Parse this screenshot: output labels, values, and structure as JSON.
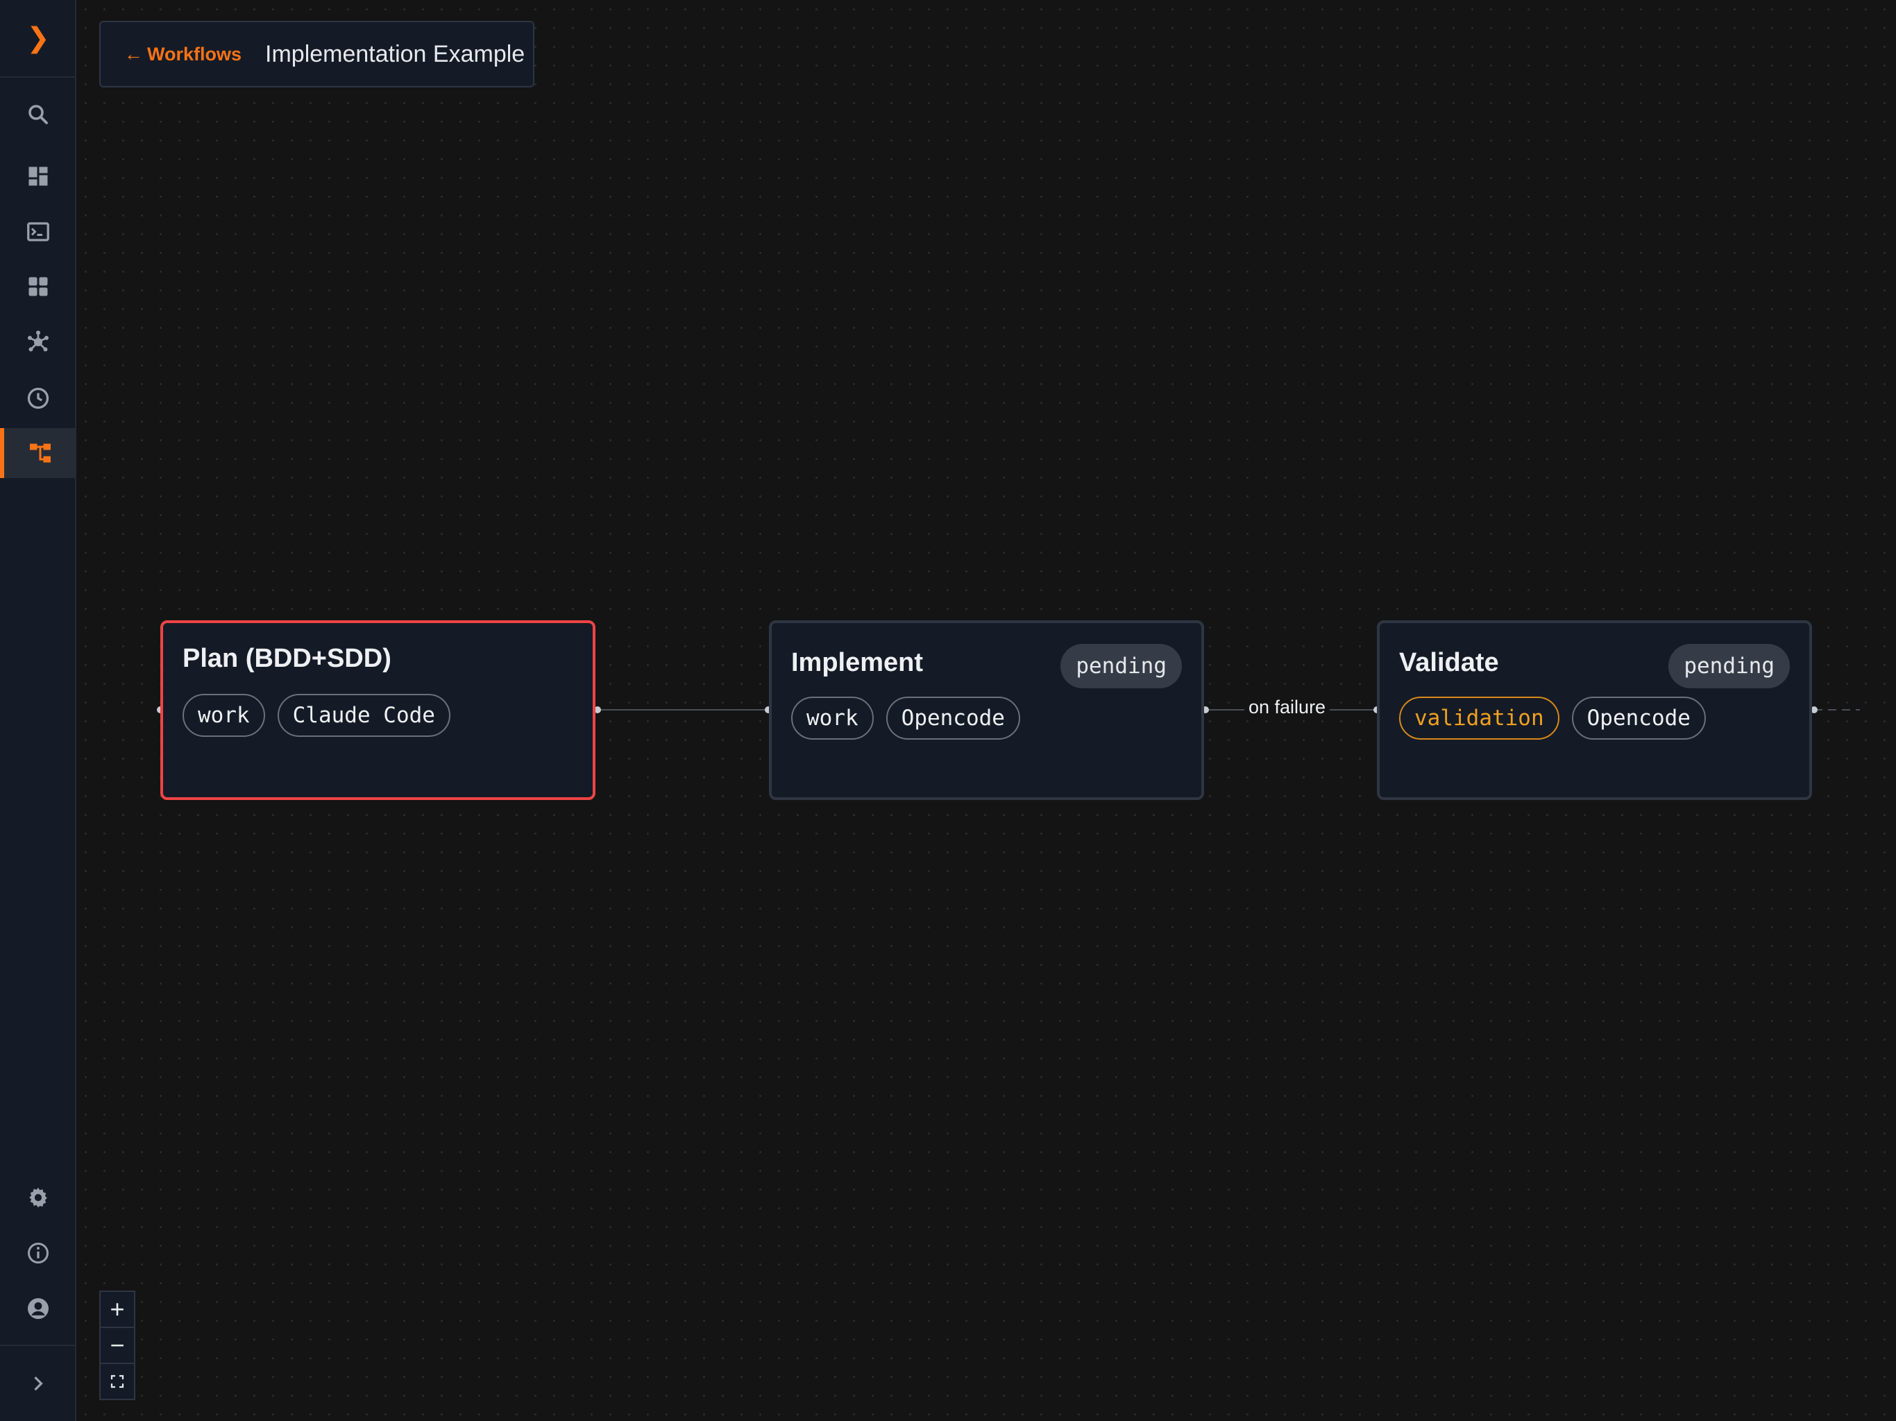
{
  "sidebar": {
    "toggle_icon": "chevron-right-icon",
    "items": [
      {
        "name": "search-icon"
      },
      {
        "name": "dashboard-icon"
      },
      {
        "name": "terminal-icon"
      },
      {
        "name": "apps-grid-icon"
      },
      {
        "name": "network-hub-icon"
      },
      {
        "name": "clock-history-icon"
      },
      {
        "name": "workflow-tree-icon",
        "active": true
      }
    ],
    "bottom_items": [
      {
        "name": "gear-icon"
      },
      {
        "name": "info-icon"
      },
      {
        "name": "account-circle-icon"
      }
    ],
    "expand_icon": "chevron-right-icon"
  },
  "header": {
    "back_label": "Workflows",
    "title": "Implementation Example"
  },
  "nodes": [
    {
      "title": "Plan (BDD+SDD)",
      "status": "",
      "tags": [
        "work",
        "Claude Code"
      ],
      "selected": true
    },
    {
      "title": "Implement",
      "status": "pending",
      "tags": [
        "work",
        "Opencode"
      ],
      "selected": false
    },
    {
      "title": "Validate",
      "status": "pending",
      "tags": [
        "validation",
        "Opencode"
      ],
      "selected": false
    }
  ],
  "edges": [
    {
      "from": "Plan (BDD+SDD)",
      "to": "Implement",
      "label": ""
    },
    {
      "from": "Implement",
      "to": "Validate",
      "label": "on failure"
    }
  ],
  "zoom_controls": {
    "zoom_in": "+",
    "zoom_out": "−",
    "fit_icon": "fit-view-icon"
  },
  "colors": {
    "accent": "#f97316",
    "selected_border": "#ef4444",
    "validation_tag": "#f0a020",
    "background": "#141414",
    "panel": "#151b26"
  }
}
